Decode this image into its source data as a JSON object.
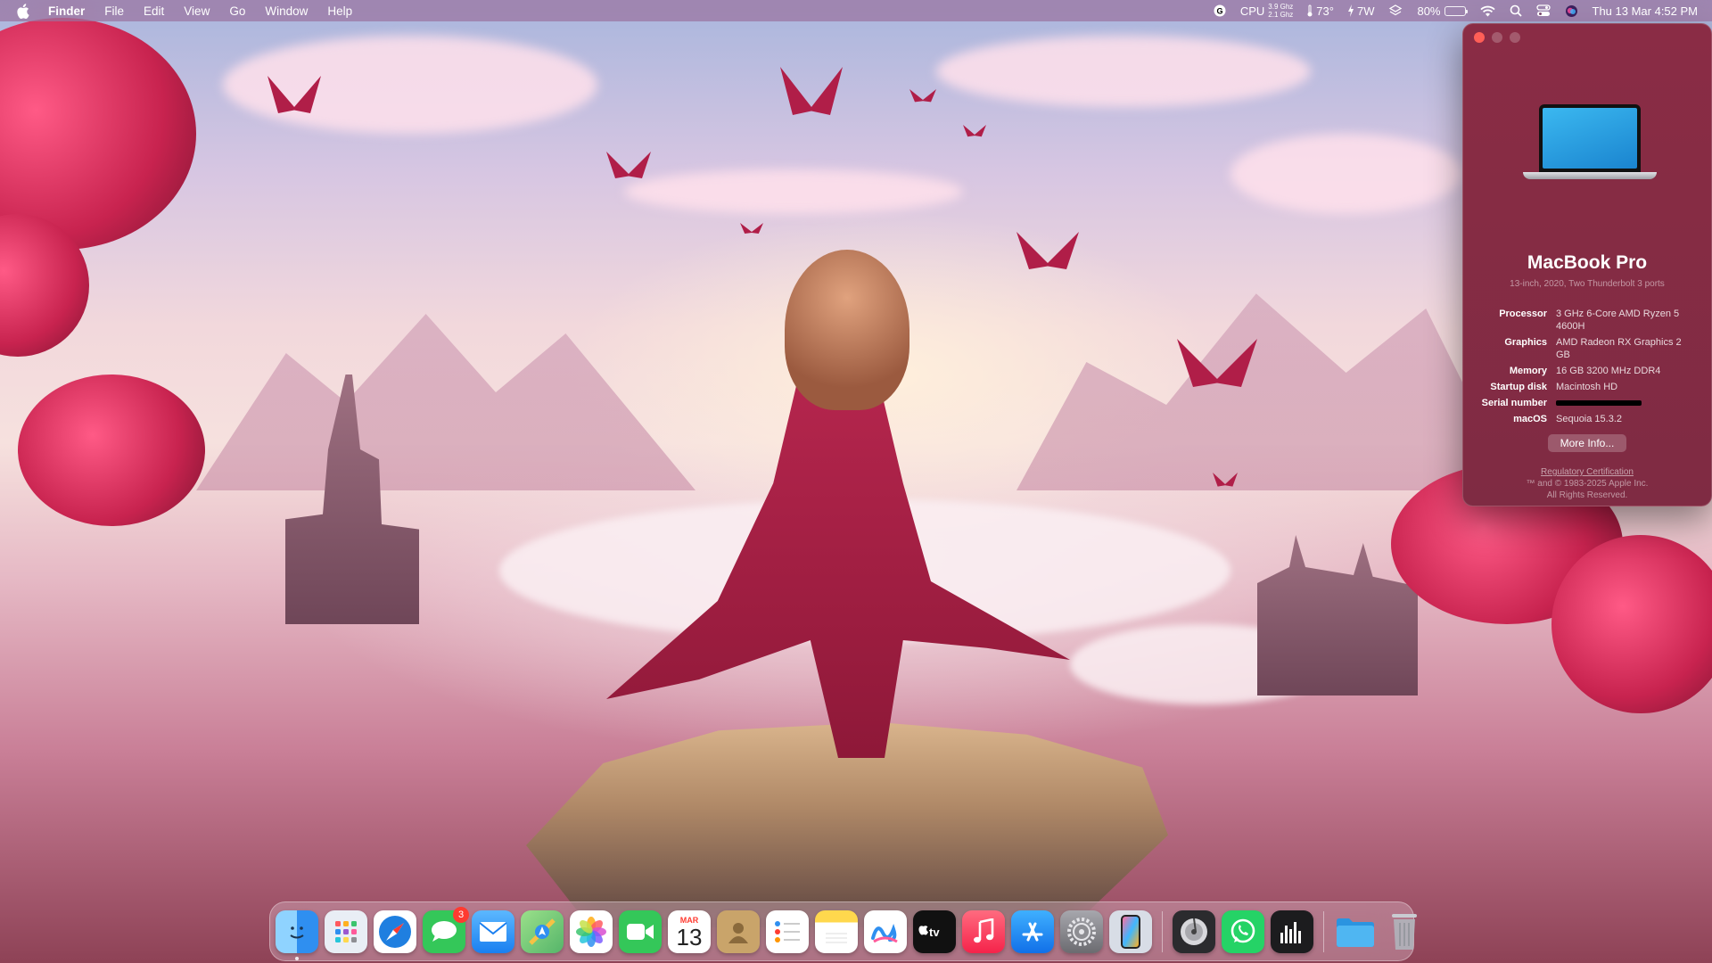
{
  "menubar": {
    "app_name": "Finder",
    "menus": [
      "File",
      "Edit",
      "View",
      "Go",
      "Window",
      "Help"
    ],
    "status": {
      "cpu_label": "CPU",
      "cpu_freq_top": "3.9 Ghz",
      "cpu_freq_bottom": "2.1 Ghz",
      "temperature": "73°",
      "power": "7W",
      "battery_percent": "80%",
      "battery_level": 0.8,
      "datetime": "Thu 13 Mar  4:52 PM"
    }
  },
  "about_window": {
    "model_name": "MacBook Pro",
    "model_sub": "13-inch, 2020, Two Thunderbolt 3 ports",
    "specs": {
      "processor_label": "Processor",
      "processor_value": "3 GHz 6-Core AMD Ryzen 5 4600H",
      "graphics_label": "Graphics",
      "graphics_value": "AMD Radeon RX Graphics 2 GB",
      "memory_label": "Memory",
      "memory_value": "16 GB 3200 MHz DDR4",
      "startup_label": "Startup disk",
      "startup_value": "Macintosh HD",
      "serial_label": "Serial number",
      "macos_label": "macOS",
      "macos_value": "Sequoia 15.3.2"
    },
    "more_info_label": "More Info...",
    "regulatory_link": "Regulatory Certification",
    "copyright": "™ and © 1983-2025 Apple Inc.",
    "rights": "All Rights Reserved."
  },
  "dock": {
    "messages_badge": "3",
    "calendar_month": "MAR",
    "calendar_day": "13",
    "colors": {
      "finder": "#2f8ff0",
      "launchpad": "#e9eef5",
      "safari": "#1f7fe0",
      "messages": "#34c759",
      "mail": "#2a8cf3",
      "maps": "#6bc46e",
      "facetime": "#34c759",
      "contacts": "#c9a46a",
      "notes": "#ffd84d",
      "freeform": "#ffffff",
      "tv": "#111111",
      "music": "#fa3d5a",
      "appstore": "#1b8ff2",
      "settings": "#8e8e93",
      "iphone_mirroring": "#d8dde6",
      "disk_utility": "#e8e8e8",
      "whatsapp": "#25d366",
      "activity_monitor": "#1c1c1e",
      "folder": "#39a8ee",
      "trash": "#b0b4bb"
    }
  }
}
